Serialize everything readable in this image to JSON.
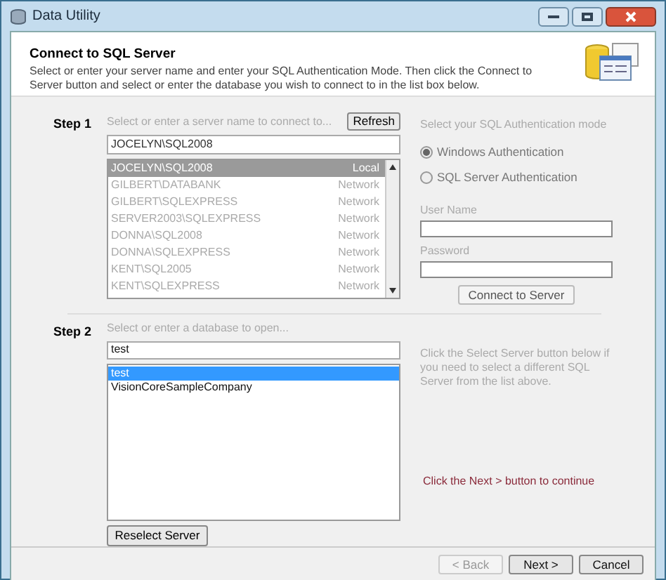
{
  "window": {
    "title": "Data Utility"
  },
  "header": {
    "title": "Connect to SQL Server",
    "description": "Select or enter your server name and enter your SQL Authentication Mode.  Then click the Connect to Server button and select or enter the database you wish to connect to in the list box below."
  },
  "step1": {
    "label": "Step 1",
    "hint": "Select or enter a server name to connect to...",
    "refresh_button": "Refresh",
    "server_field": "JOCELYN\\SQL2008",
    "servers_disabled": true,
    "servers": [
      {
        "name": "JOCELYN\\SQL2008",
        "type": "Local",
        "selected": true
      },
      {
        "name": "GILBERT\\DATABANK",
        "type": "Network",
        "selected": false
      },
      {
        "name": "GILBERT\\SQLEXPRESS",
        "type": "Network",
        "selected": false
      },
      {
        "name": "SERVER2003\\SQLEXPRESS",
        "type": "Network",
        "selected": false
      },
      {
        "name": "DONNA\\SQL2008",
        "type": "Network",
        "selected": false
      },
      {
        "name": "DONNA\\SQLEXPRESS",
        "type": "Network",
        "selected": false
      },
      {
        "name": "KENT\\SQL2005",
        "type": "Network",
        "selected": false
      },
      {
        "name": "KENT\\SQLEXPRESS",
        "type": "Network",
        "selected": false
      }
    ]
  },
  "auth": {
    "hint": "Select your SQL Authentication mode",
    "disabled": true,
    "modes": [
      {
        "label": "Windows Authentication",
        "selected": true
      },
      {
        "label": "SQL Server Authentication",
        "selected": false
      }
    ],
    "user_name_label": "User Name",
    "password_label": "Password",
    "connect_button": "Connect to Server"
  },
  "step2": {
    "label": "Step 2",
    "hint": "Select or enter a database to open...",
    "database_field": "test",
    "databases": [
      {
        "name": "test",
        "selected": true
      },
      {
        "name": "VisionCoreSampleCompany",
        "selected": false
      }
    ],
    "reselect_button": "Reselect Server",
    "note": "Click the Select Server button below if you need to select a different SQL Server from the list above.",
    "continue_hint": "Click the Next > button to continue"
  },
  "footer": {
    "buttons": [
      {
        "label": "< Back",
        "disabled": true
      },
      {
        "label": "Next >",
        "disabled": false
      },
      {
        "label": "Cancel",
        "disabled": false
      }
    ]
  }
}
